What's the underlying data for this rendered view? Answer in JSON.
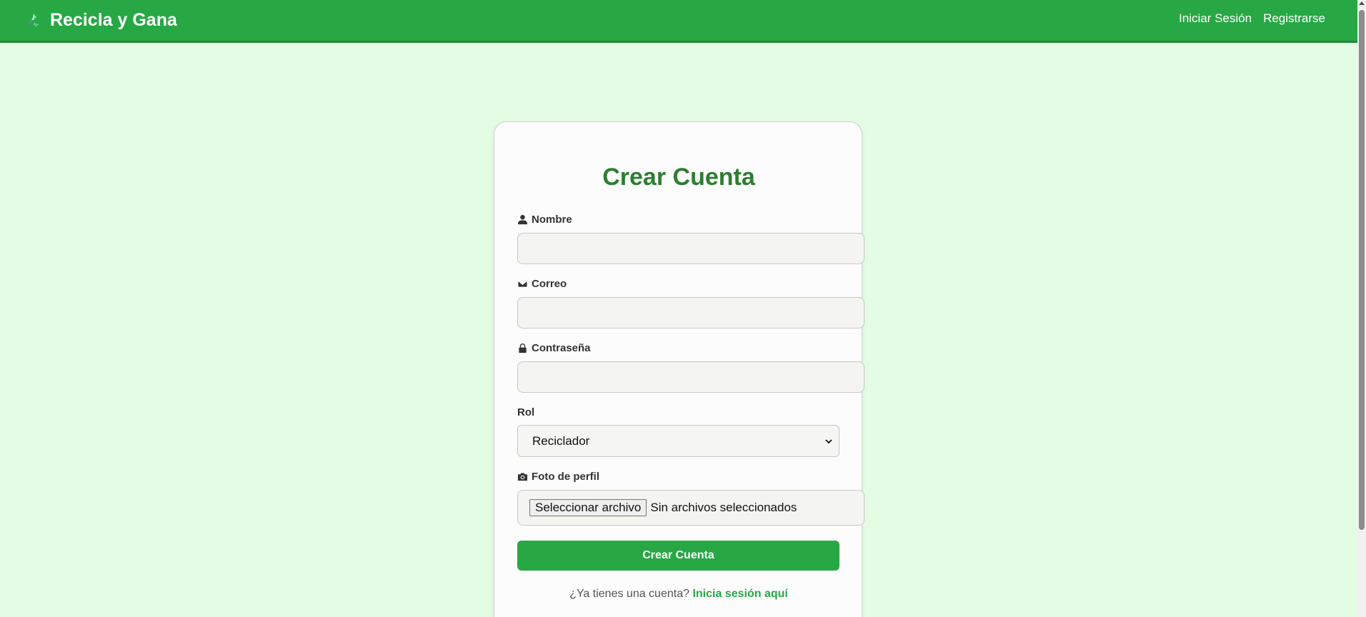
{
  "navbar": {
    "brand": "Recicla y Gana",
    "brand_icon": "recycle-icon",
    "links": [
      "Iniciar Sesión",
      "Registrarse"
    ]
  },
  "form": {
    "title": "Crear Cuenta",
    "nombre": {
      "label": "Nombre",
      "icon": "user-icon",
      "value": ""
    },
    "correo": {
      "label": "Correo",
      "icon": "envelope-icon",
      "value": ""
    },
    "contrasena": {
      "label": "Contraseña",
      "icon": "lock-icon",
      "value": ""
    },
    "rol": {
      "label": "Rol",
      "selected": "Reciclador"
    },
    "foto": {
      "label": "Foto de perfil",
      "icon": "camera-icon",
      "button": "Seleccionar archivo",
      "status": "Sin archivos seleccionados"
    },
    "submit": "Crear Cuenta",
    "footer_prompt": "¿Ya tienes una cuenta?",
    "footer_link": "Inicia sesión aquí"
  },
  "colors": {
    "primary": "#28a745",
    "title": "#2e7d32",
    "background": "#e4fbe4"
  }
}
